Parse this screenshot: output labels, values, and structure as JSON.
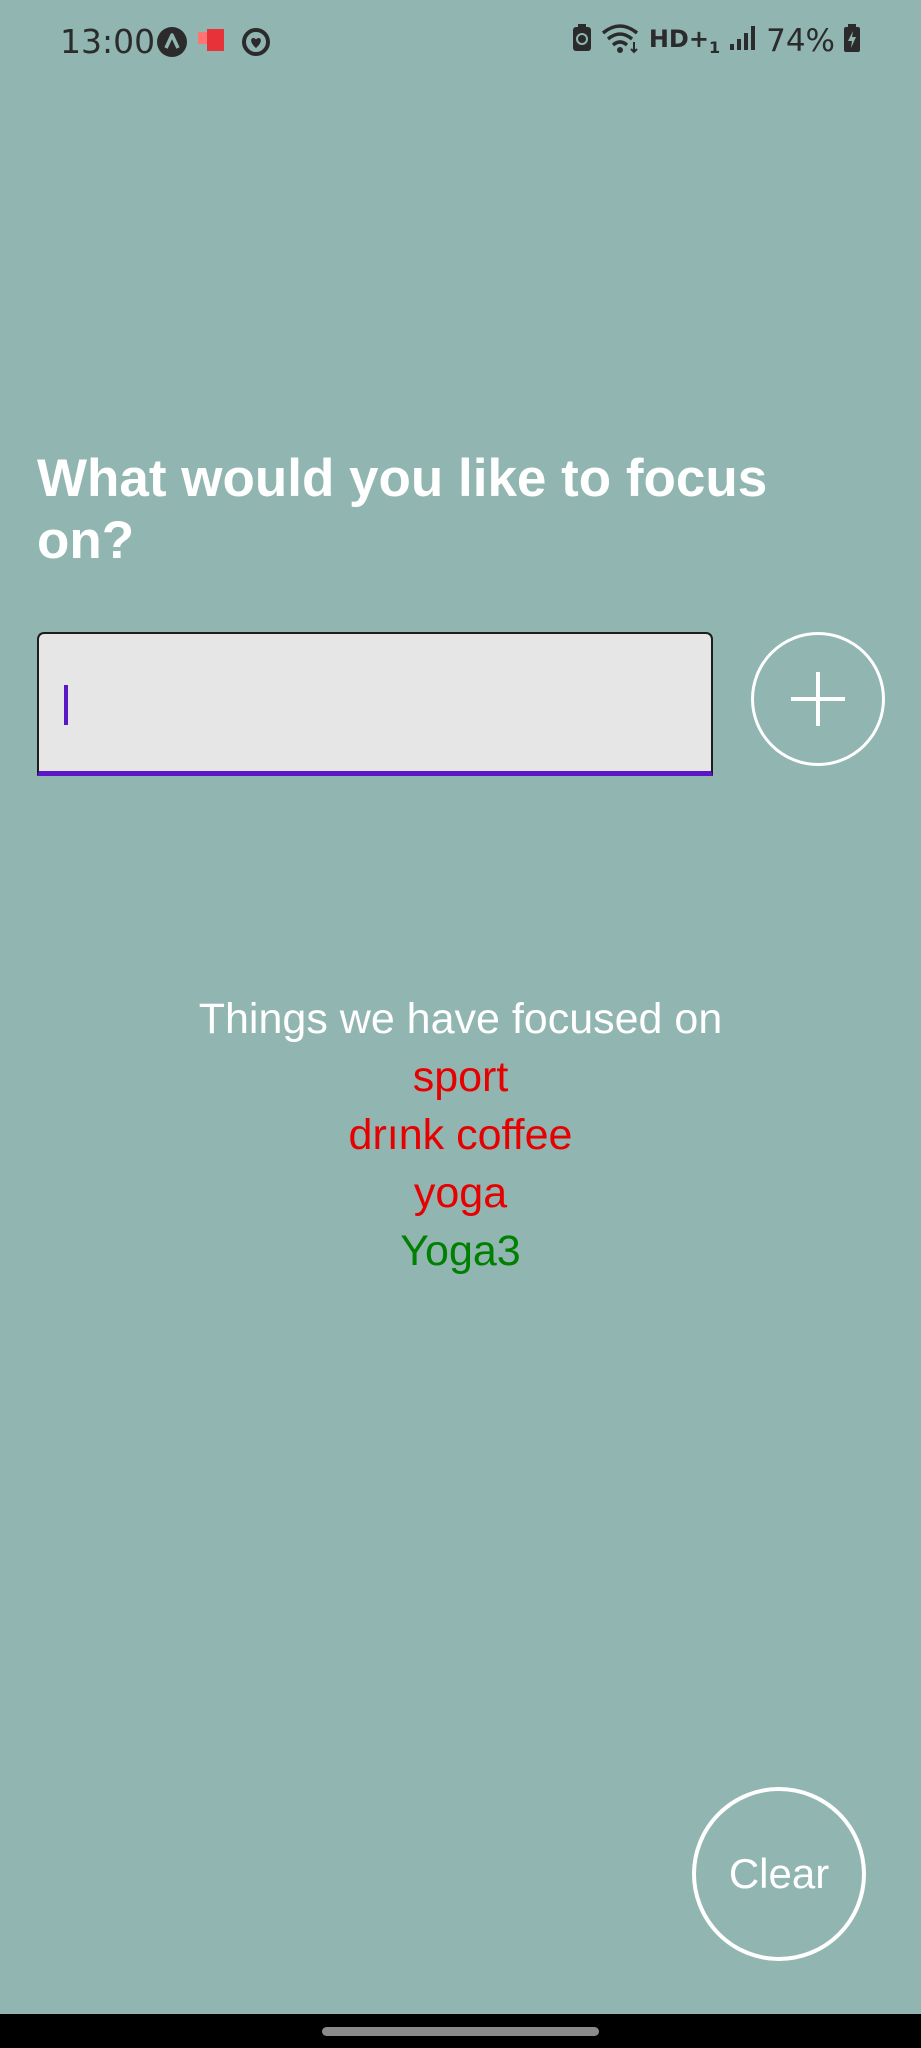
{
  "status_bar": {
    "time": "13:00",
    "battery": "74%",
    "left_icons": [
      "navigation-a-icon",
      "red-app-icon",
      "circle-heart-icon"
    ],
    "right_icons": [
      "battery-saver-icon",
      "wifi-icon",
      "hd-voice-icon",
      "signal-icon",
      "battery-charging-icon"
    ],
    "hd_label": "HD+",
    "hd_sub": "1"
  },
  "prompt": {
    "title": "What would you like to focus on?"
  },
  "input": {
    "value": "",
    "placeholder": ""
  },
  "add_button": {
    "icon": "plus-icon"
  },
  "history": {
    "title": "Things we have focused on",
    "items": [
      {
        "label": "sport",
        "color": "#e60000"
      },
      {
        "label": "drınk coffee",
        "color": "#e60000"
      },
      {
        "label": "yoga",
        "color": "#e60000"
      },
      {
        "label": "Yoga3",
        "color": "#008000"
      }
    ]
  },
  "clear_button": {
    "label": "Clear"
  },
  "colors": {
    "background": "#91b6b1",
    "accent": "#5a16c7",
    "done": "#008000",
    "pending": "#e60000"
  }
}
